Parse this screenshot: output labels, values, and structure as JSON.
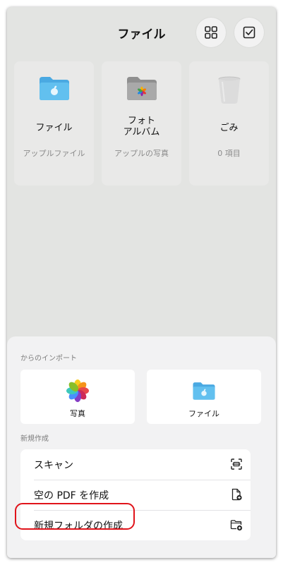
{
  "header": {
    "title": "ファイル",
    "grid_icon": "grid-icon",
    "select_icon": "checkbox-icon"
  },
  "cards": [
    {
      "title": "ファイル",
      "subtitle": "アップルファイル",
      "icon": "folder-apple-icon"
    },
    {
      "title": "フォト\nアルバム",
      "subtitle": "アップルの写真",
      "icon": "photos-folder-icon"
    },
    {
      "title": "ごみ",
      "subtitle": "0 項目",
      "icon": "trash-icon"
    }
  ],
  "import": {
    "label": "からのインポート",
    "items": [
      {
        "label": "写真",
        "icon": "photos-icon"
      },
      {
        "label": "ファイル",
        "icon": "folder-apple-icon"
      }
    ]
  },
  "create": {
    "label": "新規作成",
    "items": [
      {
        "label": "スキャン",
        "icon": "scan-icon"
      },
      {
        "label": "空の PDF を作成",
        "icon": "new-pdf-icon"
      },
      {
        "label": "新規フォルダの作成",
        "icon": "new-folder-icon"
      }
    ]
  },
  "colors": {
    "background": "#e3e4e2",
    "sheet": "#f2f2f3",
    "folder_blue": "#5ab8ea",
    "highlight": "#e0131a"
  }
}
